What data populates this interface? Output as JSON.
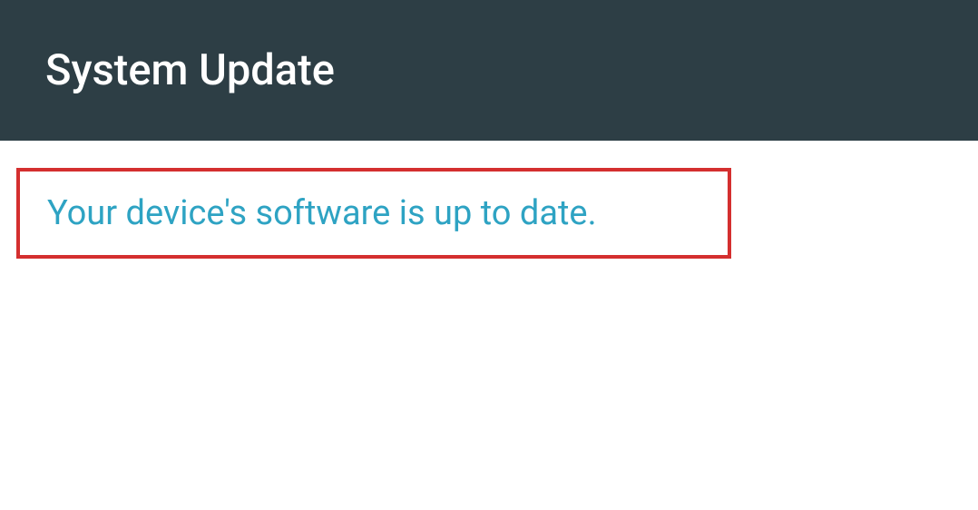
{
  "header": {
    "title": "System Update"
  },
  "content": {
    "status_message": "Your device's software is up to date."
  },
  "colors": {
    "header_bg": "#2d3e45",
    "status_text": "#2ea3c3",
    "highlight_border": "#d42f2f"
  }
}
